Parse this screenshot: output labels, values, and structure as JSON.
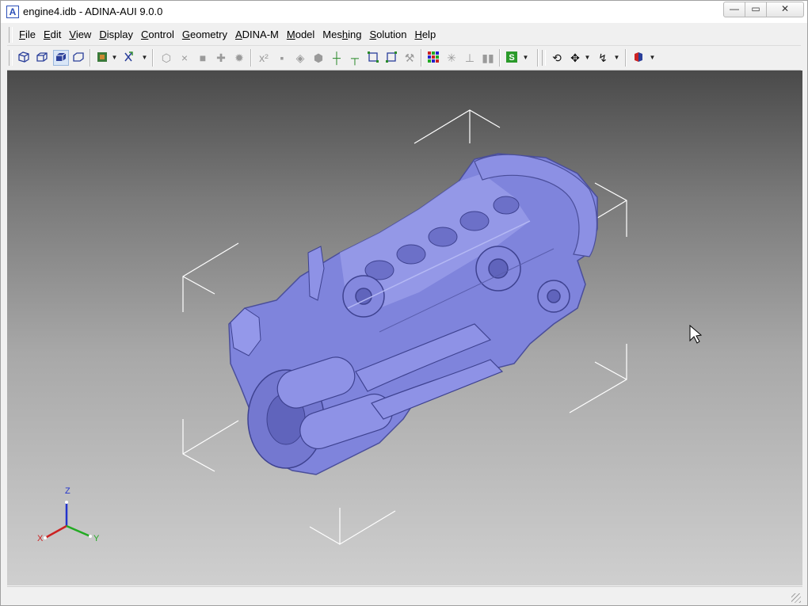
{
  "window": {
    "title": "engine4.idb - ADINA-AUI  9.0.0",
    "app_icon_letter": "A",
    "controls": {
      "minimize": "—",
      "maximize": "▭",
      "close": "✕"
    }
  },
  "menu": {
    "items": [
      {
        "id": "file",
        "pre": "",
        "ul": "F",
        "post": "ile"
      },
      {
        "id": "edit",
        "pre": "",
        "ul": "E",
        "post": "dit"
      },
      {
        "id": "view",
        "pre": "",
        "ul": "V",
        "post": "iew"
      },
      {
        "id": "display",
        "pre": "",
        "ul": "D",
        "post": "isplay"
      },
      {
        "id": "control",
        "pre": "",
        "ul": "C",
        "post": "ontrol"
      },
      {
        "id": "geometry",
        "pre": "",
        "ul": "G",
        "post": "eometry"
      },
      {
        "id": "adina-m",
        "pre": "",
        "ul": "A",
        "post": "DINA-M"
      },
      {
        "id": "model",
        "pre": "",
        "ul": "M",
        "post": "odel"
      },
      {
        "id": "meshing",
        "pre": "Mes",
        "ul": "h",
        "post": "ing"
      },
      {
        "id": "solution",
        "pre": "",
        "ul": "S",
        "post": "olution"
      },
      {
        "id": "help",
        "pre": "",
        "ul": "H",
        "post": "elp"
      }
    ]
  },
  "toolbar": {
    "icons": [
      "iso-view-icon",
      "front-view-icon",
      "shaded-view-icon",
      "wireframe-view-icon",
      "mesh-plot-icon",
      "axes-toggle-icon",
      "solid-icon",
      "point-icon",
      "square-icon",
      "cross-icon",
      "gear-icon",
      "coordinate-icon",
      "save-icon",
      "node-icon",
      "element-icon",
      "axis-icon",
      "axis-alt-icon",
      "frame-icon",
      "fit-icon",
      "cut-icon",
      "color-grid-icon",
      "star-icon",
      "tree-icon",
      "bar-icon",
      "solution-icon",
      "rotate-icon",
      "pan-icon",
      "zoom-icon",
      "cube-icon"
    ]
  },
  "viewport": {
    "model_name": "engine",
    "model_color": "#8a8ee6",
    "triad": {
      "z": "Z",
      "x": "X",
      "y": "Y",
      "colors": {
        "z": "#2233cc",
        "x": "#cc2222",
        "y": "#22aa22"
      }
    }
  },
  "statusbar": {
    "text": ""
  }
}
